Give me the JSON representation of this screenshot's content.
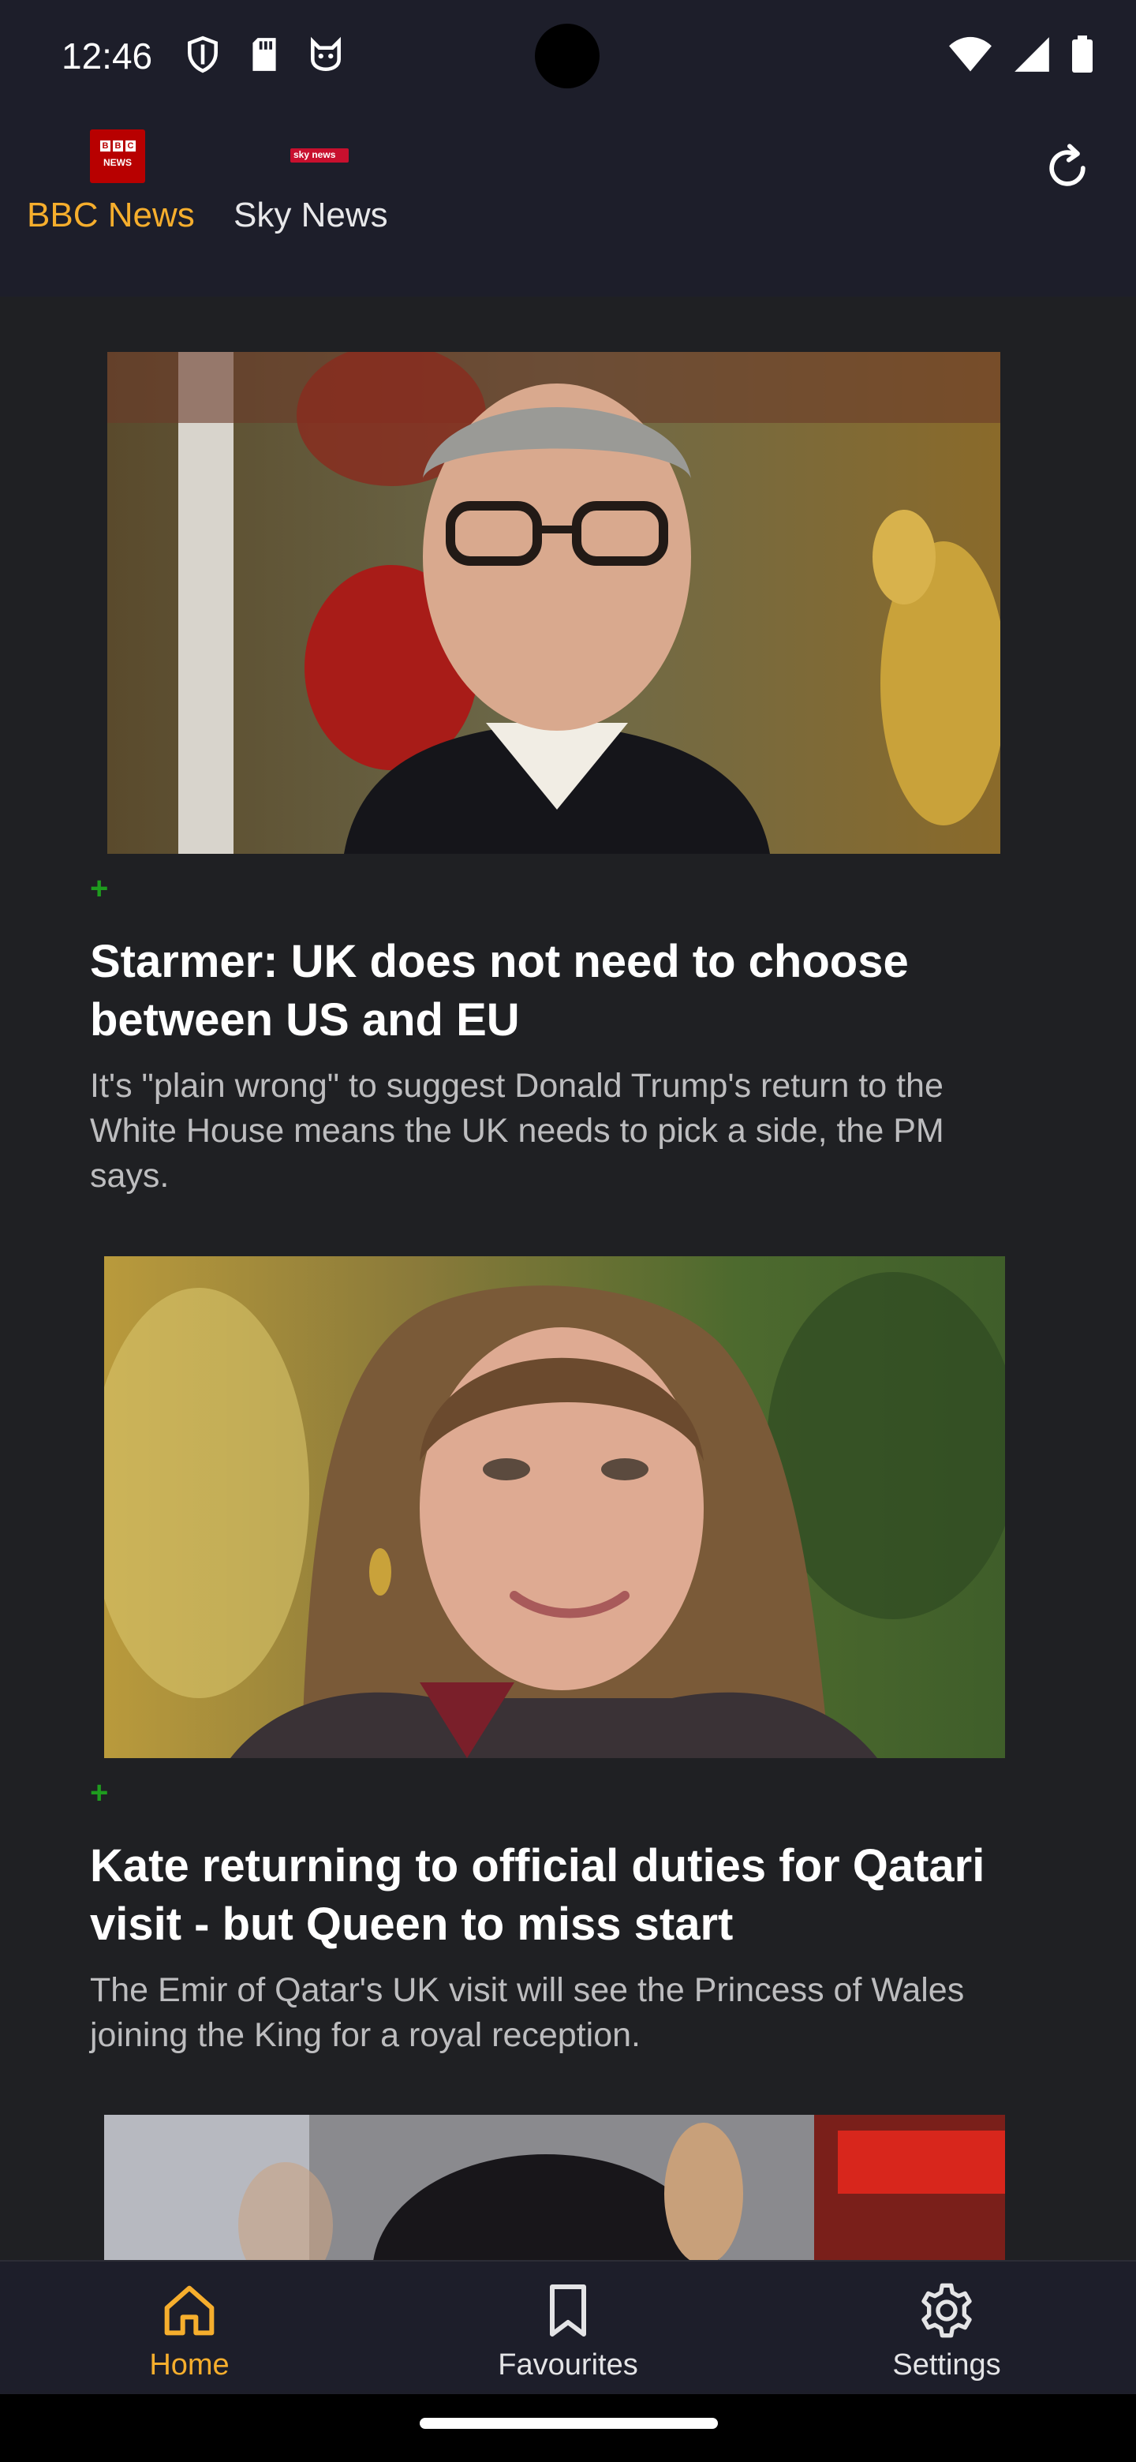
{
  "status_bar": {
    "time": "12:46",
    "left_icons": [
      "shield-icon",
      "sd-card-icon",
      "cat-face-icon"
    ],
    "right_icons": [
      "wifi-icon",
      "signal-icon",
      "battery-icon"
    ]
  },
  "header": {
    "tabs": [
      {
        "label": "BBC News",
        "logo": "bbc-news-logo",
        "logo_text": "BBC NEWS",
        "selected": true
      },
      {
        "label": "Sky News",
        "logo": "sky-news-logo",
        "logo_text": "sky news",
        "selected": false
      }
    ],
    "refresh_icon": "refresh-icon"
  },
  "articles": [
    {
      "badge": "+",
      "headline": "Starmer: UK does not need to choose between US and EU",
      "summary": "It's \"plain wrong\" to suggest Donald Trump's return to the White House means the UK needs to pick a side, the PM says."
    },
    {
      "badge": "+",
      "headline": "Kate returning to official duties for Qatari visit - but Queen to miss start",
      "summary": "The Emir of Qatar's UK visit will see the Princess of Wales joining the King for a royal reception."
    }
  ],
  "bottom_nav": {
    "items": [
      {
        "label": "Home",
        "icon": "home-icon",
        "selected": true
      },
      {
        "label": "Favourites",
        "icon": "bookmark-icon",
        "selected": false
      },
      {
        "label": "Settings",
        "icon": "settings-icon",
        "selected": false
      }
    ]
  },
  "colors": {
    "accent": "#f6ae2d",
    "background": "#1f2023",
    "bar_background": "#1d1e2a",
    "badge_green": "#1e9c1e",
    "bbc_red": "#b80000",
    "sky_red": "#c8102e"
  }
}
